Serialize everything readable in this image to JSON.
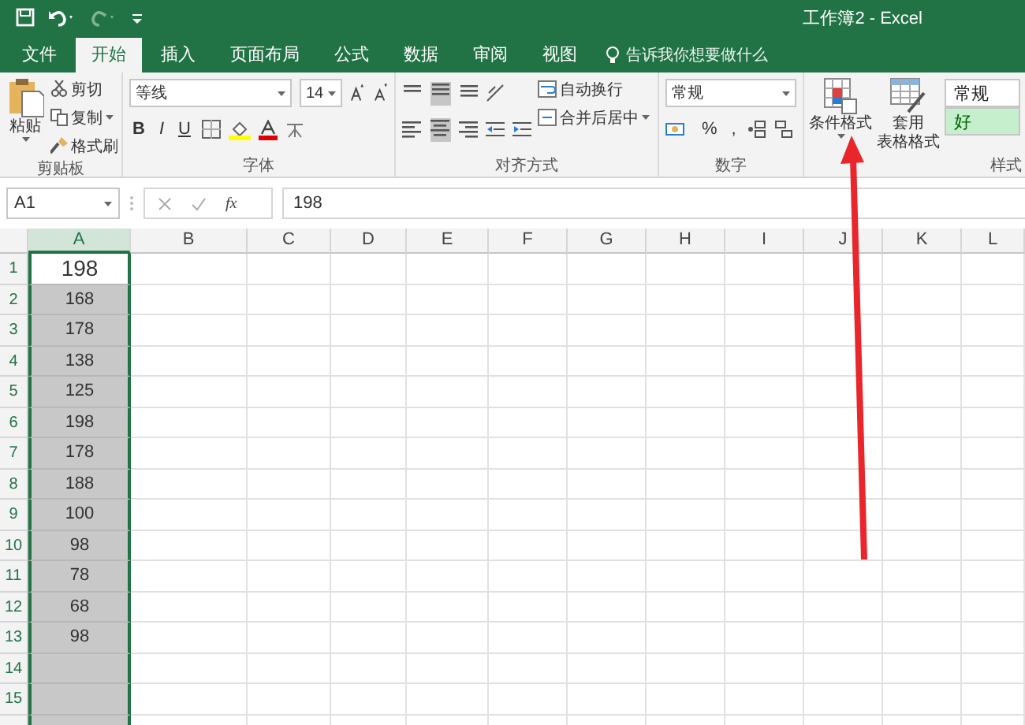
{
  "title_bar": {
    "title": "工作簿2  -  Excel"
  },
  "tabs": [
    {
      "label": "文件",
      "selected": false
    },
    {
      "label": "开始",
      "selected": true
    },
    {
      "label": "插入",
      "selected": false
    },
    {
      "label": "页面布局",
      "selected": false
    },
    {
      "label": "公式",
      "selected": false
    },
    {
      "label": "数据",
      "selected": false
    },
    {
      "label": "审阅",
      "selected": false
    },
    {
      "label": "视图",
      "selected": false
    }
  ],
  "tell_me": {
    "placeholder": "告诉我你想要做什么"
  },
  "ribbon": {
    "clipboard": {
      "paste": "粘贴",
      "cut": "剪切",
      "copy": "复制",
      "format_painter": "格式刷",
      "label": "剪贴板"
    },
    "font": {
      "font_name": "等线",
      "font_size": "14",
      "style_buttons": [
        "B",
        "I",
        "U"
      ],
      "label": "字体"
    },
    "alignment": {
      "wrap_text": "自动换行",
      "merge_center": "合并后居中",
      "label": "对齐方式"
    },
    "number": {
      "format": "常规",
      "percent": "%",
      "comma": ",",
      "label": "数字"
    },
    "styles": {
      "conditional_formatting": "条件格式",
      "format_as_table": [
        "套用",
        "表格格式"
      ],
      "cell_styles": [
        {
          "label": "常规",
          "kind": "normal"
        },
        {
          "label": "好",
          "kind": "good"
        }
      ],
      "label": "样式"
    }
  },
  "formula_bar": {
    "name_box": "A1",
    "fx": "fx",
    "formula": "198"
  },
  "grid": {
    "columns": [
      {
        "label": "A",
        "selected": true
      },
      {
        "label": "B",
        "selected": false
      },
      {
        "label": "C",
        "selected": false
      },
      {
        "label": "D",
        "selected": false
      },
      {
        "label": "E",
        "selected": false
      },
      {
        "label": "F",
        "selected": false
      },
      {
        "label": "G",
        "selected": false
      },
      {
        "label": "H",
        "selected": false
      },
      {
        "label": "I",
        "selected": false
      },
      {
        "label": "J",
        "selected": false
      },
      {
        "label": "K",
        "selected": false
      },
      {
        "label": "L",
        "selected": false
      }
    ],
    "rows": [
      {
        "label": "1",
        "cells": [
          {
            "value": "198",
            "active": true
          }
        ]
      },
      {
        "label": "2",
        "cells": [
          {
            "value": "168",
            "active": false
          }
        ]
      },
      {
        "label": "3",
        "cells": [
          {
            "value": "178",
            "active": false
          }
        ]
      },
      {
        "label": "4",
        "cells": [
          {
            "value": "138",
            "active": false
          }
        ]
      },
      {
        "label": "5",
        "cells": [
          {
            "value": "125",
            "active": false
          }
        ]
      },
      {
        "label": "6",
        "cells": [
          {
            "value": "198",
            "active": false
          }
        ]
      },
      {
        "label": "7",
        "cells": [
          {
            "value": "178",
            "active": false
          }
        ]
      },
      {
        "label": "8",
        "cells": [
          {
            "value": "188",
            "active": false
          }
        ]
      },
      {
        "label": "9",
        "cells": [
          {
            "value": "100",
            "active": false
          }
        ]
      },
      {
        "label": "10",
        "cells": [
          {
            "value": "98",
            "active": false
          }
        ]
      },
      {
        "label": "11",
        "cells": [
          {
            "value": "78",
            "active": false
          }
        ]
      },
      {
        "label": "12",
        "cells": [
          {
            "value": "68",
            "active": false
          }
        ]
      },
      {
        "label": "13",
        "cells": [
          {
            "value": "98",
            "active": false
          }
        ]
      },
      {
        "label": "14",
        "cells": [
          {
            "active": false
          }
        ]
      },
      {
        "label": "15",
        "cells": [
          {
            "active": false
          }
        ]
      }
    ]
  }
}
